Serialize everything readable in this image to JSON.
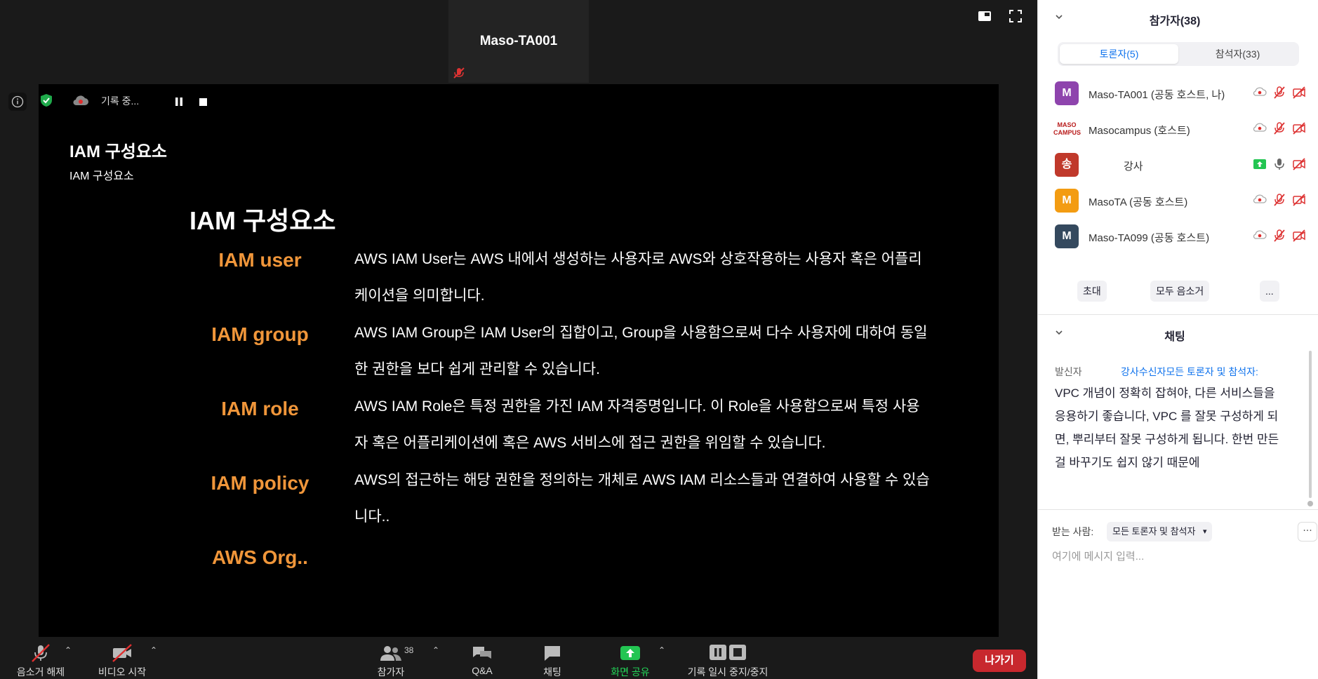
{
  "stage": {
    "speaker_name": "Maso-TA001",
    "recording_label": "기록 중..."
  },
  "slide": {
    "title_small": "IAM 구성요소",
    "subtitle_small": "IAM 구성요소",
    "heading": "IAM 구성요소",
    "items": [
      {
        "term": "IAM user",
        "desc": "AWS IAM User는 AWS 내에서 생성하는 사용자로 AWS와 상호작용하는 사용자 혹은 어플리케이션을 의미합니다."
      },
      {
        "term": "IAM group",
        "desc": "AWS IAM Group은 IAM User의 집합이고, Group을 사용함으로써 다수 사용자에 대하여 동일한 권한을 보다 쉽게 관리할 수 있습니다."
      },
      {
        "term": "IAM role",
        "desc": "AWS IAM Role은 특정 권한을 가진 IAM 자격증명입니다. 이 Role을 사용함으로써 특정 사용자 혹은 어플리케이션에 혹은 AWS 서비스에 접근 권한을 위임할 수 있습니다."
      },
      {
        "term": "IAM policy",
        "desc": "AWS의 접근하는 해당 권한을 정의하는 개체로 AWS IAM 리소스들과 연결하여 사용할 수 있습니다.."
      },
      {
        "term": "AWS Org..",
        "desc": ""
      }
    ]
  },
  "toolbar": {
    "unmute": "음소거 해제",
    "start_video": "비디오 시작",
    "participants": "참가자",
    "participants_count": "38",
    "qa": "Q&A",
    "chat": "채팅",
    "share_screen": "화면 공유",
    "pause_stop_recording": "기록 일시 중지/중지",
    "leave": "나가기"
  },
  "panel": {
    "title": "참가자(38)",
    "tabs": [
      "토론자(5)",
      "참석자(33)"
    ],
    "panelists": [
      {
        "initial": "M",
        "color": "#8e44ad",
        "name": "Maso-TA001 (공동 호스트, 나)"
      },
      {
        "initial": "MASO CAMPUS",
        "color": "#ffffff",
        "name": "Masocampus (호스트)"
      },
      {
        "initial": "송",
        "color": "#c0392b",
        "name": "강사"
      },
      {
        "initial": "M",
        "color": "#f39c12",
        "name": "MasoTA (공동 호스트)"
      },
      {
        "initial": "M",
        "color": "#34495e",
        "name": "Maso-TA099 (공동 호스트)"
      }
    ],
    "actions": {
      "invite": "초대",
      "mute_all": "모두 음소거",
      "more": "..."
    }
  },
  "chat": {
    "title": "채팅",
    "from_label": "발신자",
    "to_label": "강사수신자모든 토론자 및 참석자:",
    "message": "VPC 개념이 정확히 잡혀야, 다른 서비스들을 응용하기 좋습니다, VPC 를 잘못 구성하게 되면, 뿌리부터 잘못 구성하게 됩니다. 한번 만든걸 바꾸기도 쉽지 않기 때문에",
    "recipient_label": "받는 사람:",
    "recipient_value": "모든 토론자 및 참석자",
    "input_placeholder": "여기에 메시지 입력..."
  }
}
